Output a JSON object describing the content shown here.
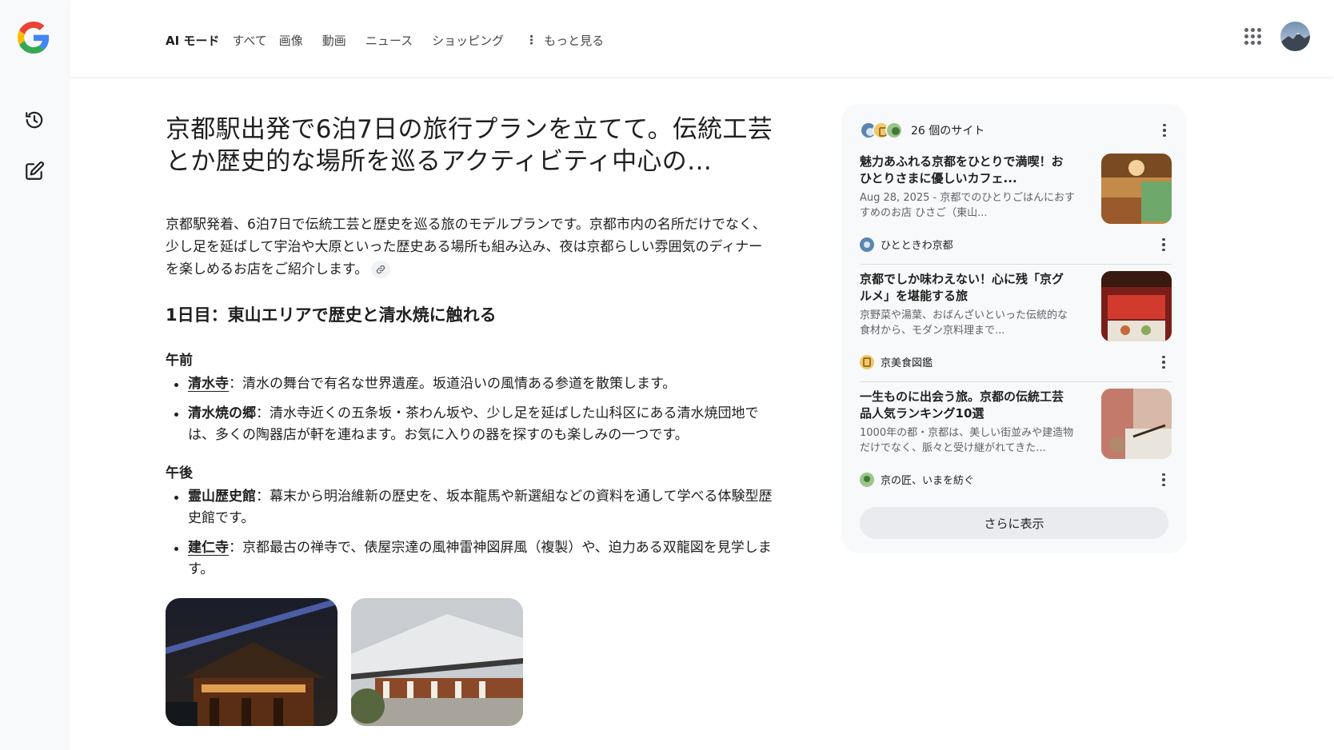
{
  "colors": {
    "google_blue": "#4285F4",
    "google_red": "#EA4335",
    "google_yellow": "#FBBC05",
    "google_green": "#34A853",
    "text_primary": "#1f1f1f",
    "text_secondary": "#5f6368",
    "panel_bg": "#f8f9fa"
  },
  "sidebar": {
    "logo_icon": "google-g-icon",
    "items": [
      {
        "icon": "history-icon"
      },
      {
        "icon": "new-chat-edit-icon"
      }
    ]
  },
  "header": {
    "tabs": [
      {
        "label": "AI モード",
        "active": true
      },
      {
        "label": "すべて"
      },
      {
        "label": "画像"
      },
      {
        "label": "動画"
      },
      {
        "label": "ニュース"
      },
      {
        "label": "ショッピング"
      }
    ],
    "more_label": "もっと見る",
    "apps_icon": "apps-grid-icon",
    "avatar_icon": "profile-avatar"
  },
  "main": {
    "query": "京都駅出発で6泊7日の旅行プランを立てて。伝統工芸とか歴史的な場所を巡るアクティビティ中心の…",
    "intro": "京都駅発着、6泊7日で伝統工芸と歴史を巡る旅のモデルプランです。京都市内の名所だけでなく、少し足を延ばして宇治や大原といった歴史ある場所も組み込み、夜は京都らしい雰囲気のディナーを楽しめるお店をご紹介します。",
    "day1": {
      "heading": "1日目：東山エリアで歴史と清水焼に触れる",
      "morning": {
        "label": "午前",
        "items": [
          {
            "term": "清水寺",
            "text": "：清水の舞台で有名な世界遺産。坂道沿いの風情ある参道を散策します。"
          },
          {
            "term": "清水焼の郷",
            "text": "：清水寺近くの五条坂・茶わん坂や、少し足を延ばした山科区にある清水焼団地では、多くの陶器店が軒を連ねます。お気に入りの器を探すのも楽しみの一つです。"
          }
        ]
      },
      "afternoon": {
        "label": "午後",
        "items": [
          {
            "term": "霊山歴史館",
            "text": "：幕末から明治維新の歴史を、坂本龍馬や新選組などの資料を通して学べる体験型歴史館です。"
          },
          {
            "term": "建仁寺",
            "text": "：京都最古の禅寺で、俵屋宗達の風神雷神図屛風（複製）や、迫力ある双龍図を見学します。"
          }
        ]
      }
    },
    "images": [
      {
        "icon": "kiyomizu-temple-night-photo"
      },
      {
        "icon": "kenninji-temple-photo"
      }
    ]
  },
  "sources": {
    "count_label": "26 個のサイト",
    "cards": [
      {
        "title": "魅力あふれる京都をひとりで満喫！おひとりさまに優しいカフェ...",
        "snippet": "Aug 28, 2025 - 京都でのひとりごはんにおすすめのお店 ひさご（東山...",
        "site": "ひとときわ京都",
        "icon": "cafe-interior-photo"
      },
      {
        "title": "京都でしか味わえない！心に残「京グルメ」を堪能する旅",
        "snippet": "京野菜や湯葉、おばんざいといった伝統的な 食材から、モダン京料理まで...",
        "site": "京美食図鑑",
        "icon": "food-stall-photo"
      },
      {
        "title": "一生ものに出会う旅。京都の伝統工芸品人気ランキング10選",
        "snippet": "1000年の都・京都は、美しい街並みや建造物だけでなく、脈々と受け継がれてきた...",
        "site": "京の匠、いまを紡ぐ",
        "icon": "craft-painting-photo"
      }
    ],
    "show_more": "さらに表示"
  }
}
